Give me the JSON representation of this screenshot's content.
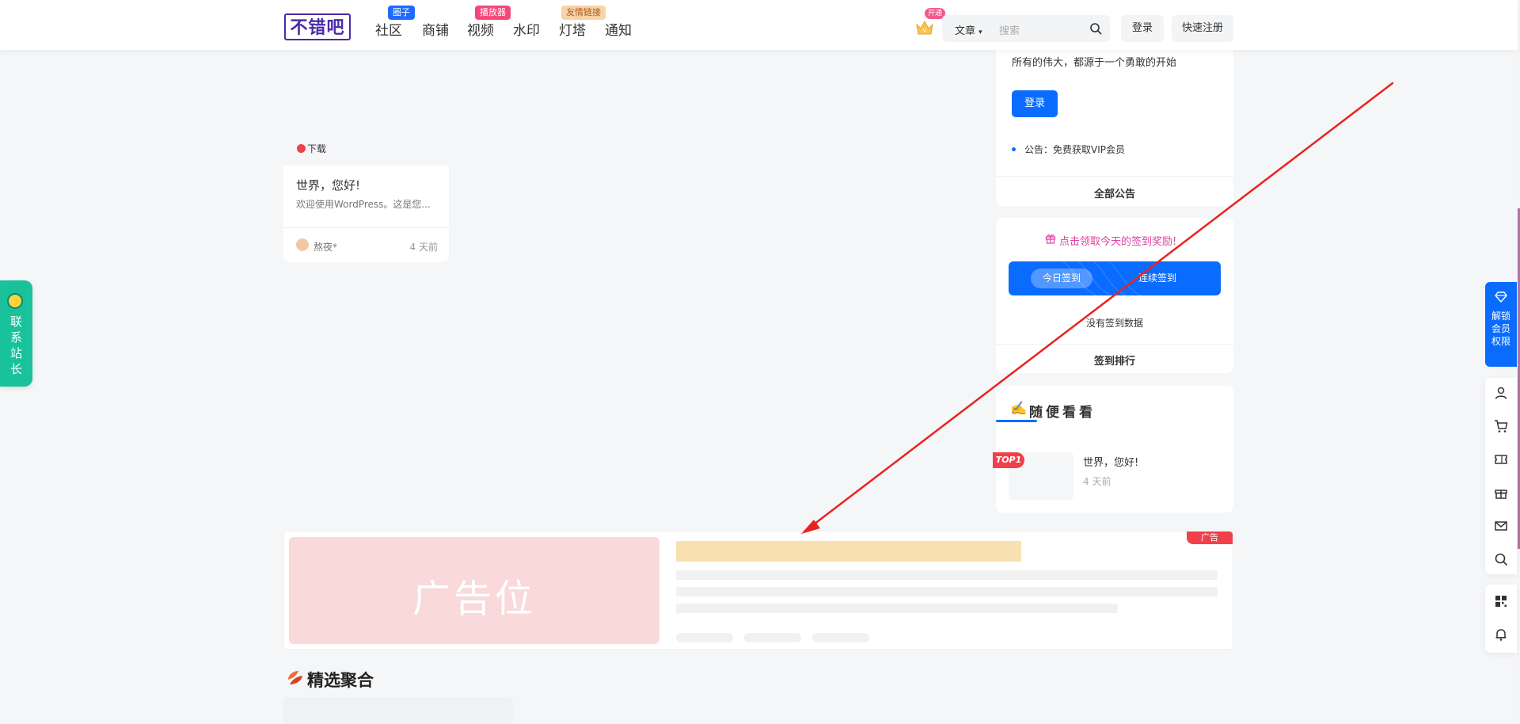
{
  "header": {
    "logo_text": "不错吧",
    "nav": [
      {
        "label": "社区",
        "badge": "圈子",
        "badge_color": "#1f6bff"
      },
      {
        "label": "商铺",
        "badge": "",
        "badge_color": ""
      },
      {
        "label": "视频",
        "badge": "播放器",
        "badge_color": "#f5477a"
      },
      {
        "label": "水印",
        "badge": "",
        "badge_color": ""
      },
      {
        "label": "灯塔",
        "badge": "友情链接",
        "badge_color": "#f8d3a6"
      },
      {
        "label": "通知",
        "badge": "",
        "badge_color": ""
      }
    ],
    "vip_badge": "开通",
    "search": {
      "type": "文章",
      "placeholder": "搜索"
    },
    "login": "登录",
    "register": "快速注册"
  },
  "post_card": {
    "download_label": "下载",
    "title": "世界，您好!",
    "excerpt": "欢迎使用WordPress。这是您...",
    "author": "熬夜*",
    "time": "4 天前"
  },
  "sidebar": {
    "user_panel": {
      "slogan": "所有的伟大，都源于一个勇敢的开始",
      "login": "登录",
      "notice": "公告：免费获取VIP会员",
      "all_notices": "全部公告"
    },
    "checkin": {
      "tip": "点击领取今天的签到奖励!",
      "today": "今日签到",
      "continuous": "连续签到",
      "no_data": "没有签到数据",
      "ranking": "签到排行"
    },
    "random": {
      "emoji": "✍️",
      "title": "随便看看",
      "badge": "TOP1",
      "post_title": "世界，您好!",
      "post_time": "4 天前"
    }
  },
  "ad": {
    "image_text": "广告位",
    "badge": "广告"
  },
  "featured": {
    "title": "精选聚合"
  },
  "float_left": {
    "contact": "联系站长"
  },
  "float_right": {
    "vip": "解锁会员权限",
    "tools": [
      "user-icon",
      "cart-icon",
      "ticket-icon",
      "gift-icon",
      "mail-icon",
      "search-icon",
      "qrcode-icon",
      "bell-icon"
    ]
  },
  "colors": {
    "primary": "#0a6cff",
    "contact": "#19c29a",
    "accent_red": "#f1404b",
    "arrow": "#e8231f"
  }
}
